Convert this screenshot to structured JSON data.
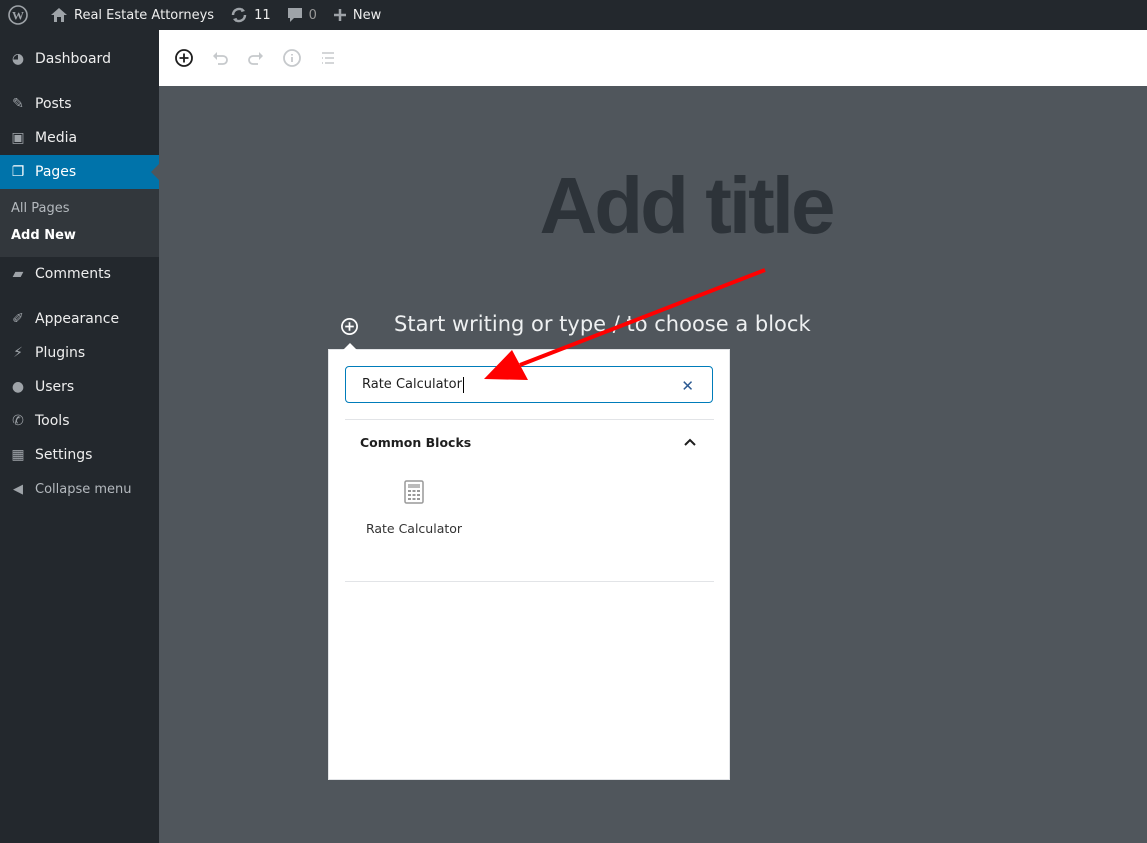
{
  "adminbar": {
    "site_name": "Real Estate Attorneys",
    "updates": "11",
    "comments": "0",
    "new_label": "New"
  },
  "sidebar": {
    "items": [
      {
        "label": "Dashboard",
        "icon": "dashboard-icon"
      },
      {
        "label": "Posts",
        "icon": "pin-icon"
      },
      {
        "label": "Media",
        "icon": "media-icon"
      },
      {
        "label": "Pages",
        "icon": "pages-icon",
        "active": true
      },
      {
        "label": "Comments",
        "icon": "comment-icon"
      },
      {
        "label": "Appearance",
        "icon": "brush-icon"
      },
      {
        "label": "Plugins",
        "icon": "plug-icon"
      },
      {
        "label": "Users",
        "icon": "user-icon"
      },
      {
        "label": "Tools",
        "icon": "wrench-icon"
      },
      {
        "label": "Settings",
        "icon": "settings-icon"
      }
    ],
    "submenu": [
      "All Pages",
      "Add New"
    ],
    "collapse_label": "Collapse menu"
  },
  "editor": {
    "title_placeholder": "Add title",
    "block_placeholder": "Start writing or type / to choose a block"
  },
  "inserter": {
    "search_value": "Rate Calculator",
    "panel_title": "Common Blocks",
    "blocks": [
      {
        "label": "Rate Calculator",
        "icon": "calculator-icon"
      }
    ]
  },
  "colors": {
    "accent": "#0073aa",
    "annotation_arrow": "#ff0000"
  }
}
